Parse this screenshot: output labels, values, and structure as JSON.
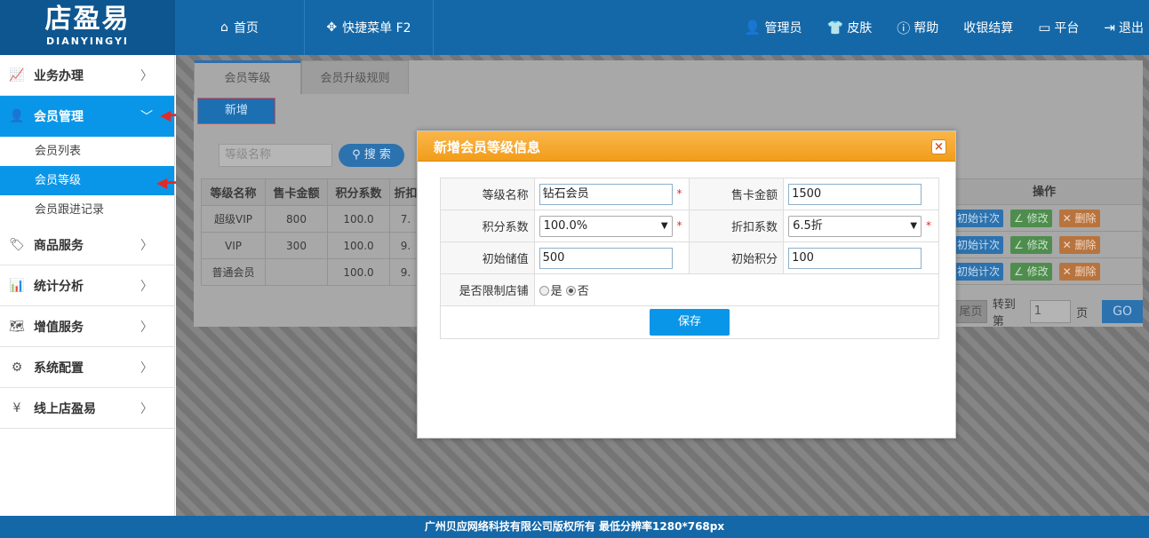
{
  "header": {
    "logo_cn": "店盈易",
    "logo_en": "DIANYINGYI",
    "home": "首页",
    "quick_menu": "快捷菜单 F2",
    "right": [
      "管理员",
      "皮肤",
      "帮助",
      "收银结算",
      "平台",
      "退出"
    ]
  },
  "sidebar": {
    "items": [
      {
        "label": "业务办理"
      },
      {
        "label": "会员管理"
      },
      {
        "label": "商品服务"
      },
      {
        "label": "统计分析"
      },
      {
        "label": "增值服务"
      },
      {
        "label": "系统配置"
      },
      {
        "label": "线上店盈易"
      }
    ],
    "sub": [
      "会员列表",
      "会员等级",
      "会员跟进记录"
    ]
  },
  "main": {
    "tabs": [
      "会员等级",
      "会员升级规则"
    ],
    "new_button": "新增",
    "search_placeholder": "等级名称",
    "search_button": "搜 索",
    "columns": [
      "等级名称",
      "售卡金额",
      "积分系数",
      "折扣"
    ],
    "rows": [
      [
        "超级VIP",
        "800",
        "100.0",
        "7."
      ],
      [
        "VIP",
        "300",
        "100.0",
        "9."
      ],
      [
        "普通会员",
        "",
        "100.0",
        "9."
      ]
    ],
    "ops_header": "操作",
    "ops": {
      "init": "初始计次",
      "edit": "修改",
      "del": "删除"
    },
    "pager": {
      "last": "尾页",
      "goto": "转到第",
      "page_value": "1",
      "page_suffix": "页",
      "go": "GO"
    }
  },
  "modal": {
    "title": "新增会员等级信息",
    "close": "×",
    "fields": {
      "level_name_label": "等级名称",
      "level_name_value": "钻石会员",
      "card_amount_label": "售卡金额",
      "card_amount_value": "1500",
      "points_label": "积分系数",
      "points_value": "100.0%",
      "discount_label": "折扣系数",
      "discount_value": "6.5折",
      "init_balance_label": "初始储值",
      "init_balance_value": "500",
      "init_points_label": "初始积分",
      "init_points_value": "100",
      "limit_store_label": "是否限制店铺",
      "radio_yes": "是",
      "radio_no": "否"
    },
    "save": "保存",
    "required": "*"
  },
  "footer": "广州贝应网络科技有限公司版权所有 最低分辨率1280*768px"
}
